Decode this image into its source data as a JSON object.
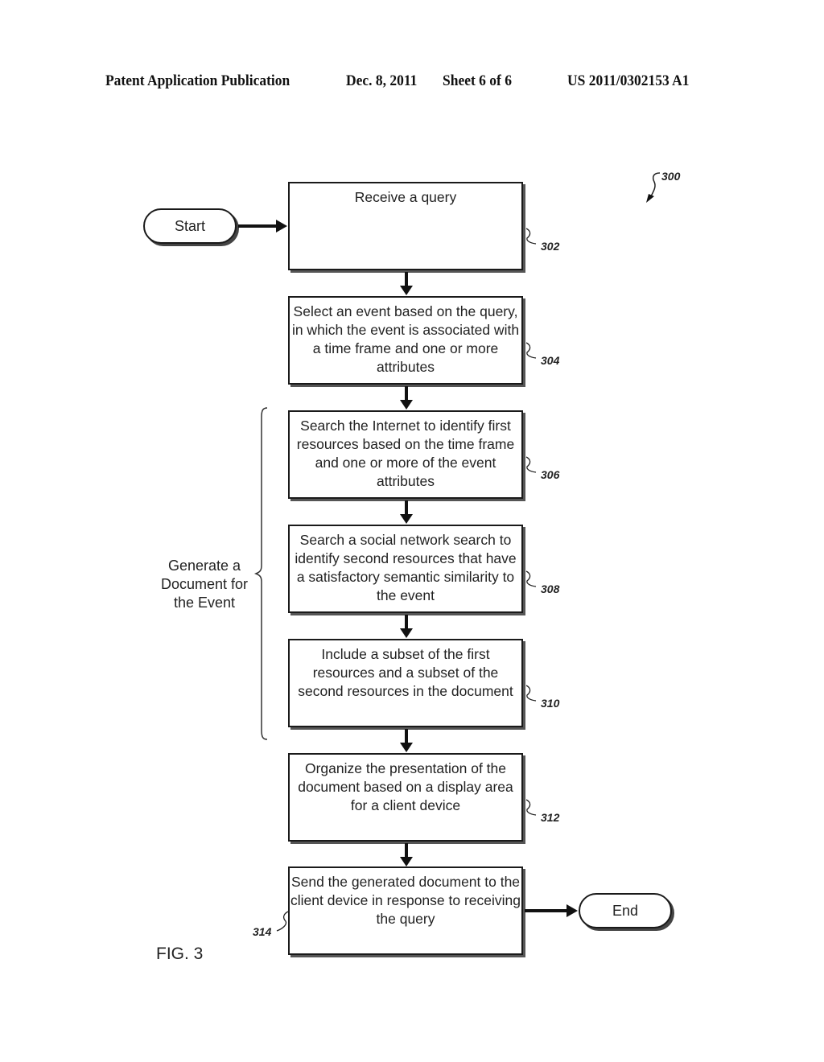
{
  "header": {
    "publication": "Patent Application Publication",
    "date": "Dec. 8, 2011",
    "sheet": "Sheet 6 of 6",
    "number": "US 2011/0302153 A1"
  },
  "figure": {
    "ref": "300",
    "caption": "FIG. 3",
    "start": "Start",
    "end": "End",
    "group_label": "Generate a Document for the Event",
    "steps": [
      {
        "ref": "302",
        "text": "Receive a query"
      },
      {
        "ref": "304",
        "text": "Select an event based on the query, in which the event is associated with a time frame and one or more attributes"
      },
      {
        "ref": "306",
        "text": "Search the Internet to identify first resources based on the time frame and one or more of the event attributes"
      },
      {
        "ref": "308",
        "text": "Search a social network search to identify second resources that have a satisfactory semantic similarity to the event"
      },
      {
        "ref": "310",
        "text": "Include a subset of the first resources and a subset of the second resources in the document"
      },
      {
        "ref": "312",
        "text": "Organize the presentation of the document based on a display area for a client device"
      },
      {
        "ref": "314",
        "text": "Send the generated document to the client device in response to receiving the query"
      }
    ]
  }
}
